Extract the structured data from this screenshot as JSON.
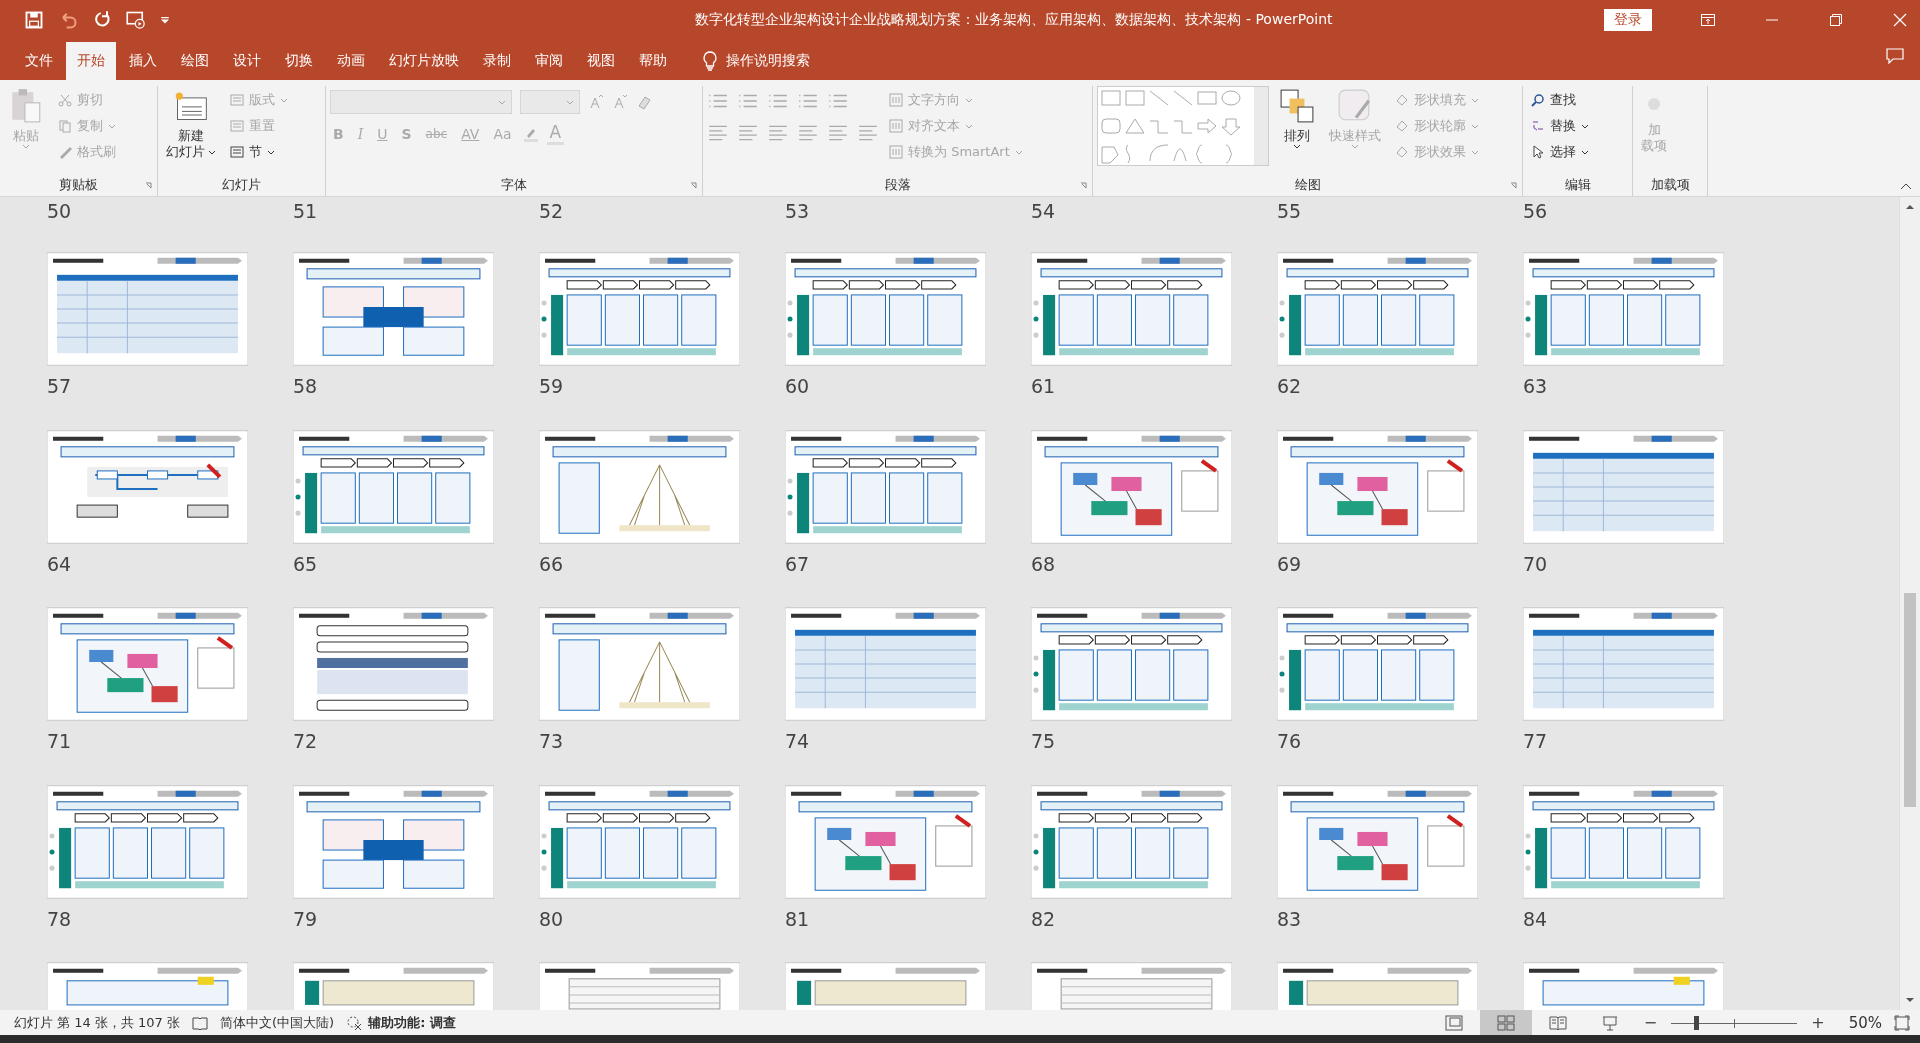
{
  "window": {
    "title": "数字化转型企业架构设计企业战略规划方案：业务架构、应用架构、数据架构、技术架构  -  PowerPoint",
    "login": "登录"
  },
  "tabs": [
    {
      "label": "文件",
      "selected": false
    },
    {
      "label": "开始",
      "selected": true
    },
    {
      "label": "插入",
      "selected": false
    },
    {
      "label": "绘图",
      "selected": false
    },
    {
      "label": "设计",
      "selected": false
    },
    {
      "label": "切换",
      "selected": false
    },
    {
      "label": "动画",
      "selected": false
    },
    {
      "label": "幻灯片放映",
      "selected": false
    },
    {
      "label": "录制",
      "selected": false
    },
    {
      "label": "审阅",
      "selected": false
    },
    {
      "label": "视图",
      "selected": false
    },
    {
      "label": "帮助",
      "selected": false
    }
  ],
  "tell_me": "操作说明搜索",
  "ribbon": {
    "clipboard": {
      "label": "剪贴板",
      "paste": "粘贴",
      "items": [
        {
          "label": "剪切",
          "disabled": true
        },
        {
          "label": "复制",
          "disabled": true
        },
        {
          "label": "格式刷",
          "disabled": true
        }
      ]
    },
    "slides": {
      "label": "幻灯片",
      "new_slide": [
        "新建",
        "幻灯片"
      ],
      "items": [
        {
          "label": "版式",
          "disabled": true
        },
        {
          "label": "重置",
          "disabled": true
        },
        {
          "label": "节",
          "disabled": false
        }
      ]
    },
    "font": {
      "label": "字体",
      "format_buttons": [
        "B",
        "I",
        "U",
        "S",
        "abc",
        "AV",
        "Aa"
      ],
      "font_color": "A"
    },
    "paragraph": {
      "label": "段落",
      "items": [
        {
          "label": "文字方向",
          "disabled": true
        },
        {
          "label": "对齐文本",
          "disabled": true
        },
        {
          "label": "转换为 SmartArt",
          "disabled": true
        }
      ]
    },
    "drawing": {
      "label": "绘图",
      "arrange": "排列",
      "quick_styles": "快速样式",
      "items": [
        {
          "label": "形状填充",
          "disabled": true
        },
        {
          "label": "形状轮廓",
          "disabled": true
        },
        {
          "label": "形状效果",
          "disabled": true
        }
      ]
    },
    "editing": {
      "label": "编辑",
      "items": [
        {
          "label": "查找",
          "disabled": false
        },
        {
          "label": "替换",
          "disabled": false
        },
        {
          "label": "选择",
          "disabled": false
        }
      ]
    },
    "addins": {
      "label": "加载项",
      "button": [
        "加",
        "载项"
      ]
    }
  },
  "sorter": {
    "top_numbers": [
      "50",
      "51",
      "52",
      "53",
      "54",
      "55",
      "56"
    ],
    "rows": [
      {
        "slides": [
          {
            "number": "57",
            "kind": "table"
          },
          {
            "number": "58",
            "kind": "blocks"
          },
          {
            "number": "59",
            "kind": "process"
          },
          {
            "number": "60",
            "kind": "process"
          },
          {
            "number": "61",
            "kind": "process"
          },
          {
            "number": "62",
            "kind": "process"
          },
          {
            "number": "63",
            "kind": "process"
          }
        ]
      },
      {
        "slides": [
          {
            "number": "64",
            "kind": "flow"
          },
          {
            "number": "65",
            "kind": "process"
          },
          {
            "number": "66",
            "kind": "tree"
          },
          {
            "number": "67",
            "kind": "process"
          },
          {
            "number": "68",
            "kind": "diagram"
          },
          {
            "number": "69",
            "kind": "diagram"
          },
          {
            "number": "70",
            "kind": "table"
          }
        ]
      },
      {
        "slides": [
          {
            "number": "71",
            "kind": "diagram"
          },
          {
            "number": "72",
            "kind": "outline"
          },
          {
            "number": "73",
            "kind": "tree"
          },
          {
            "number": "74",
            "kind": "table"
          },
          {
            "number": "75",
            "kind": "process"
          },
          {
            "number": "76",
            "kind": "process"
          },
          {
            "number": "77",
            "kind": "table"
          }
        ]
      },
      {
        "slides": [
          {
            "number": "78",
            "kind": "process"
          },
          {
            "number": "79",
            "kind": "blocks"
          },
          {
            "number": "80",
            "kind": "process"
          },
          {
            "number": "81",
            "kind": "diagram"
          },
          {
            "number": "82",
            "kind": "process"
          },
          {
            "number": "83",
            "kind": "diagram"
          },
          {
            "number": "84",
            "kind": "process"
          }
        ]
      }
    ],
    "partial_row": [
      {
        "kind": "blocks"
      },
      {
        "kind": "process"
      },
      {
        "kind": "table"
      },
      {
        "kind": "process"
      },
      {
        "kind": "table"
      },
      {
        "kind": "process"
      },
      {
        "kind": "blocks"
      }
    ]
  },
  "status_bar": {
    "slide_info": "幻灯片 第 14 张，共 107 张",
    "language": "简体中文(中国大陆)",
    "accessibility": "辅助功能: 调查",
    "views": [
      {
        "kind": "normal",
        "selected": false
      },
      {
        "kind": "sorter",
        "selected": true
      },
      {
        "kind": "reading",
        "selected": false
      },
      {
        "kind": "slideshow",
        "selected": false
      }
    ],
    "zoom": {
      "minus": "−",
      "plus": "+",
      "level": 0.2,
      "reading": "50%"
    }
  }
}
